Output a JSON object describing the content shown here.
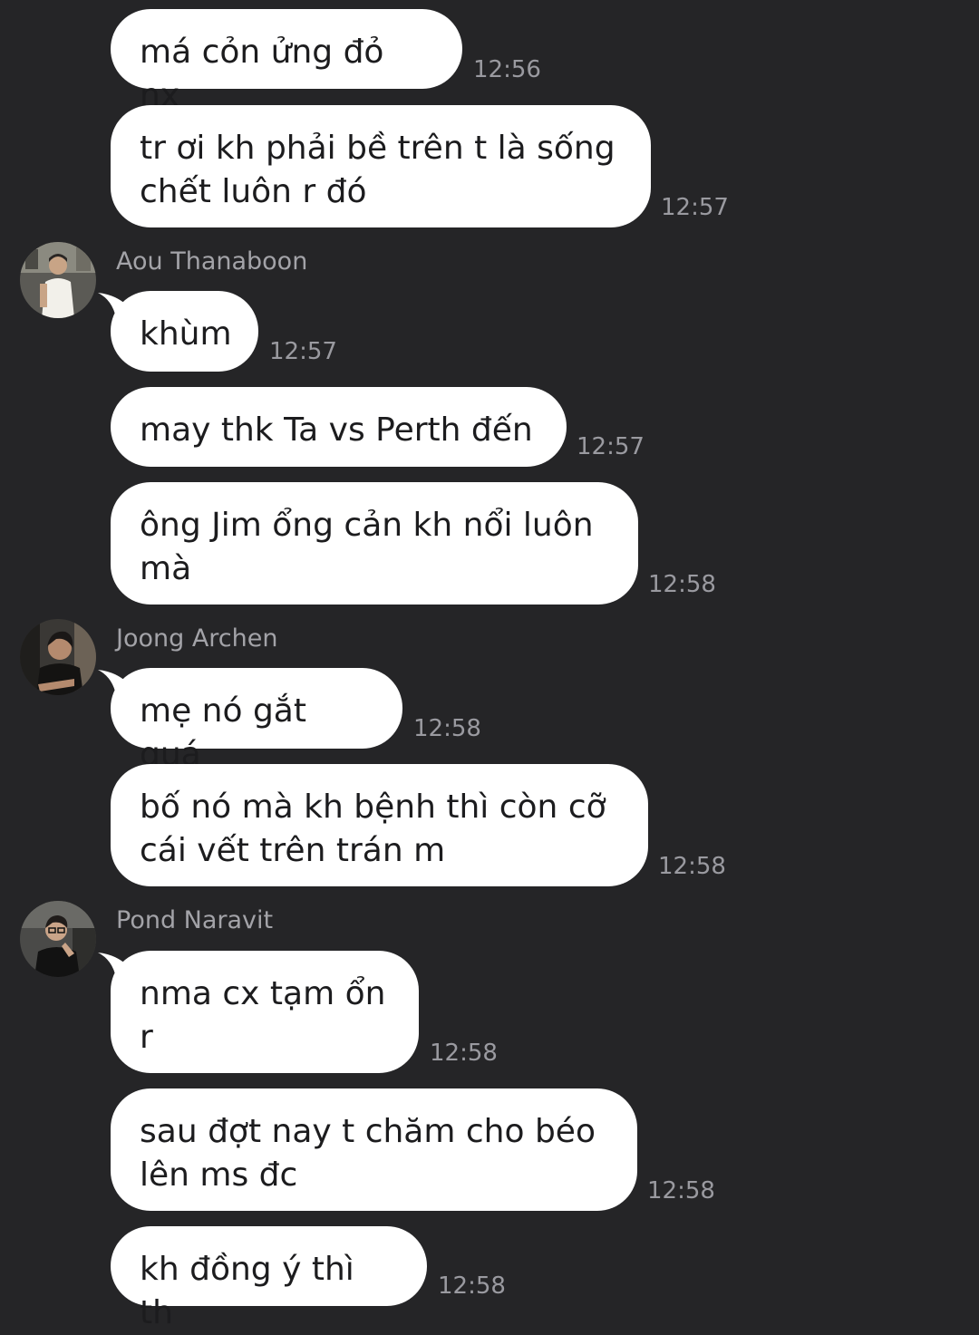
{
  "messages": [
    {
      "text": "má cỏn ửng đỏ nx",
      "time": "12:56"
    },
    {
      "text": "tr ơi kh phải bề trên t là sống chết luôn r đó",
      "time": "12:57"
    },
    {
      "sender": "Aou Thanaboon",
      "text": "khùm",
      "time": "12:57"
    },
    {
      "text": "may thk Ta vs Perth đến",
      "time": "12:57"
    },
    {
      "text": "ông Jim ổng cản kh nổi luôn mà",
      "time": "12:58"
    },
    {
      "sender": "Joong Archen",
      "text": "mẹ nó gắt quá",
      "time": "12:58"
    },
    {
      "text": "bố nó mà kh bệnh thì còn cỡ cái vết trên trán m",
      "time": "12:58"
    },
    {
      "sender": "Pond Naravit",
      "text": "nma cx tạm ổn r",
      "time": "12:58"
    },
    {
      "text": "sau đợt nay t chăm cho béo lên ms đc",
      "time": "12:58"
    },
    {
      "text": "kh đồng ý thì th",
      "time": "12:58"
    }
  ]
}
